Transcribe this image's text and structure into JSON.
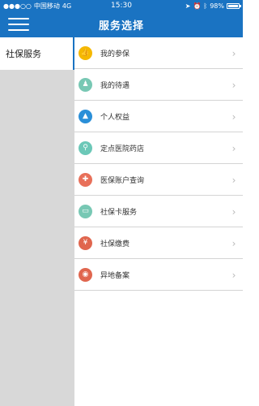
{
  "status_bar": {
    "signal": "●●●○○",
    "carrier": "中国移动",
    "network": "4G",
    "time": "15:30",
    "battery_percent": "98%",
    "battery_level": 0.98,
    "right_icons": [
      "location-icon",
      "alarm-icon",
      "bluetooth-icon"
    ]
  },
  "header": {
    "title": "服务选择"
  },
  "sidebar": {
    "items": [
      {
        "label": "社保服务"
      }
    ]
  },
  "menu": {
    "items": [
      {
        "label": "我的参保",
        "icon": "thumbs-up-icon",
        "color": "#f5b800",
        "glyph": "👍"
      },
      {
        "label": "我的待遇",
        "icon": "person-icon",
        "color": "#78c8b4",
        "glyph": "♟"
      },
      {
        "label": "个人权益",
        "icon": "graduation-cap-icon",
        "color": "#2a8fd8",
        "glyph": "▲"
      },
      {
        "label": "定点医院药店",
        "icon": "location-pin-icon",
        "color": "#6cc8b8",
        "glyph": "⚲"
      },
      {
        "label": "医保账户查询",
        "icon": "medical-kit-icon",
        "color": "#e8705a",
        "glyph": "✚"
      },
      {
        "label": "社保卡服务",
        "icon": "card-icon",
        "color": "#78c8b4",
        "glyph": "▭"
      },
      {
        "label": "社保缴费",
        "icon": "payment-icon",
        "color": "#e0664e",
        "glyph": "¥"
      },
      {
        "label": "异地备案",
        "icon": "globe-icon",
        "color": "#e0664e",
        "glyph": "◉"
      }
    ],
    "chevron": "›"
  }
}
